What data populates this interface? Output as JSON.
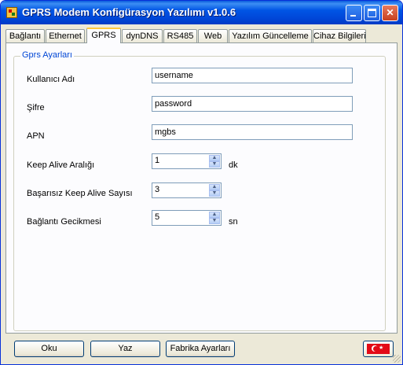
{
  "window": {
    "title": "GPRS Modem Konfigürasyon Yazılımı v1.0.6",
    "controls": [
      "minimize",
      "maximize",
      "close"
    ]
  },
  "tabs": [
    {
      "label": "Bağlantı",
      "active": false
    },
    {
      "label": "Ethernet",
      "active": false
    },
    {
      "label": "GPRS",
      "active": true
    },
    {
      "label": "dynDNS",
      "active": false
    },
    {
      "label": "RS485",
      "active": false
    },
    {
      "label": "Web",
      "active": false
    },
    {
      "label": "Yazılım Güncelleme",
      "active": false
    },
    {
      "label": "Cihaz Bilgileri",
      "active": false
    }
  ],
  "group": {
    "title": "Gprs Ayarları"
  },
  "fields": {
    "username": {
      "label": "Kullanıcı Adı",
      "value": "username"
    },
    "password": {
      "label": "Şifre",
      "value": "password"
    },
    "apn": {
      "label": "APN",
      "value": "mgbs"
    },
    "keep_alive_interval": {
      "label": "Keep Alive Aralığı",
      "value": "1",
      "unit": "dk"
    },
    "failed_keep_alive": {
      "label": "Başarısız Keep Alive Sayısı",
      "value": "3"
    },
    "connection_delay": {
      "label": "Bağlantı Gecikmesi",
      "value": "5",
      "unit": "sn"
    }
  },
  "buttons": {
    "read": "Oku",
    "write": "Yaz",
    "factory_settings": "Fabrika Ayarları"
  },
  "language": {
    "current": "Türkçe",
    "flag_icon": "turkey-flag-icon"
  },
  "colors": {
    "titlebar": "#0055e5",
    "window_bg": "#ece9d8",
    "group_title": "#0046d5",
    "tab_highlight": "#ffc83c",
    "flag_red": "#e30a17"
  }
}
